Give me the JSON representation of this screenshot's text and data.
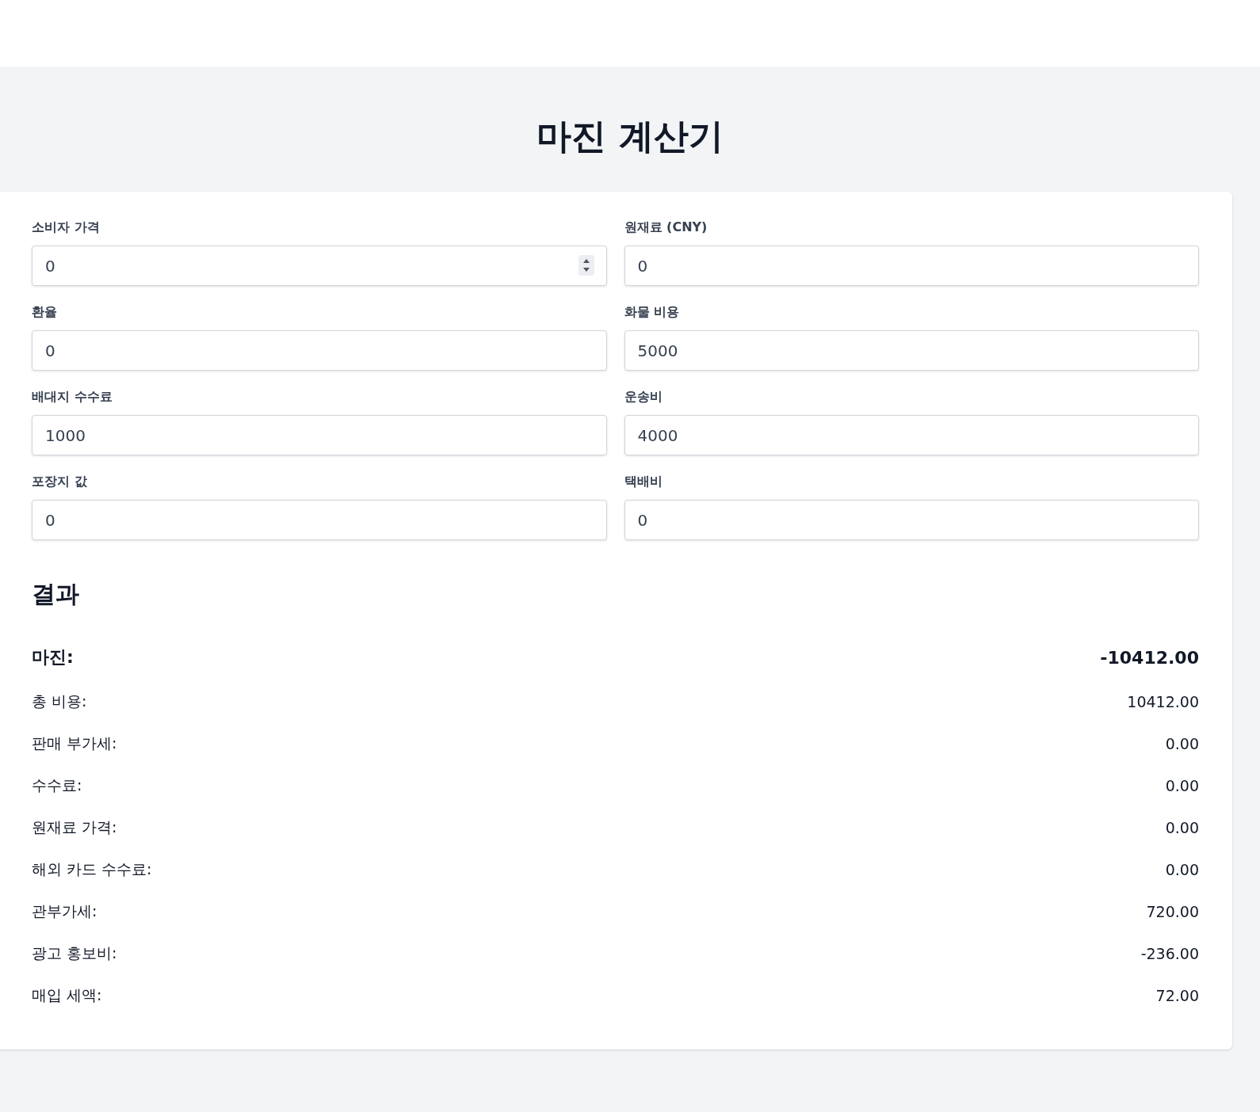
{
  "title": "마진 계산기",
  "fields": [
    {
      "label": "소비자 가격",
      "value": "0",
      "spinner": true
    },
    {
      "label": "원재료 (CNY)",
      "value": "0",
      "spinner": false
    },
    {
      "label": "환율",
      "value": "0",
      "spinner": false
    },
    {
      "label": "화물 비용",
      "value": "5000",
      "spinner": false
    },
    {
      "label": "배대지 수수료",
      "value": "1000",
      "spinner": false
    },
    {
      "label": "운송비",
      "value": "4000",
      "spinner": false
    },
    {
      "label": "포장지 값",
      "value": "0",
      "spinner": false
    },
    {
      "label": "택배비",
      "value": "0",
      "spinner": false
    }
  ],
  "results": {
    "heading": "결과",
    "rows": [
      {
        "kind": "total",
        "label": "마진:",
        "value": "-10412.00"
      },
      {
        "kind": "line",
        "label": "총 비용:",
        "value": "10412.00"
      },
      {
        "kind": "line",
        "label": "판매 부가세:",
        "value": "0.00"
      },
      {
        "kind": "line",
        "label": "수수료:",
        "value": "0.00"
      },
      {
        "kind": "line",
        "label": "원재료 가격:",
        "value": "0.00"
      },
      {
        "kind": "line",
        "label": "해외 카드 수수료:",
        "value": "0.00"
      },
      {
        "kind": "line",
        "label": "관부가세:",
        "value": "720.00"
      },
      {
        "kind": "line",
        "label": "광고 홍보비:",
        "value": "-236.00"
      },
      {
        "kind": "line",
        "label": "매입 세액:",
        "value": "72.00"
      }
    ]
  }
}
